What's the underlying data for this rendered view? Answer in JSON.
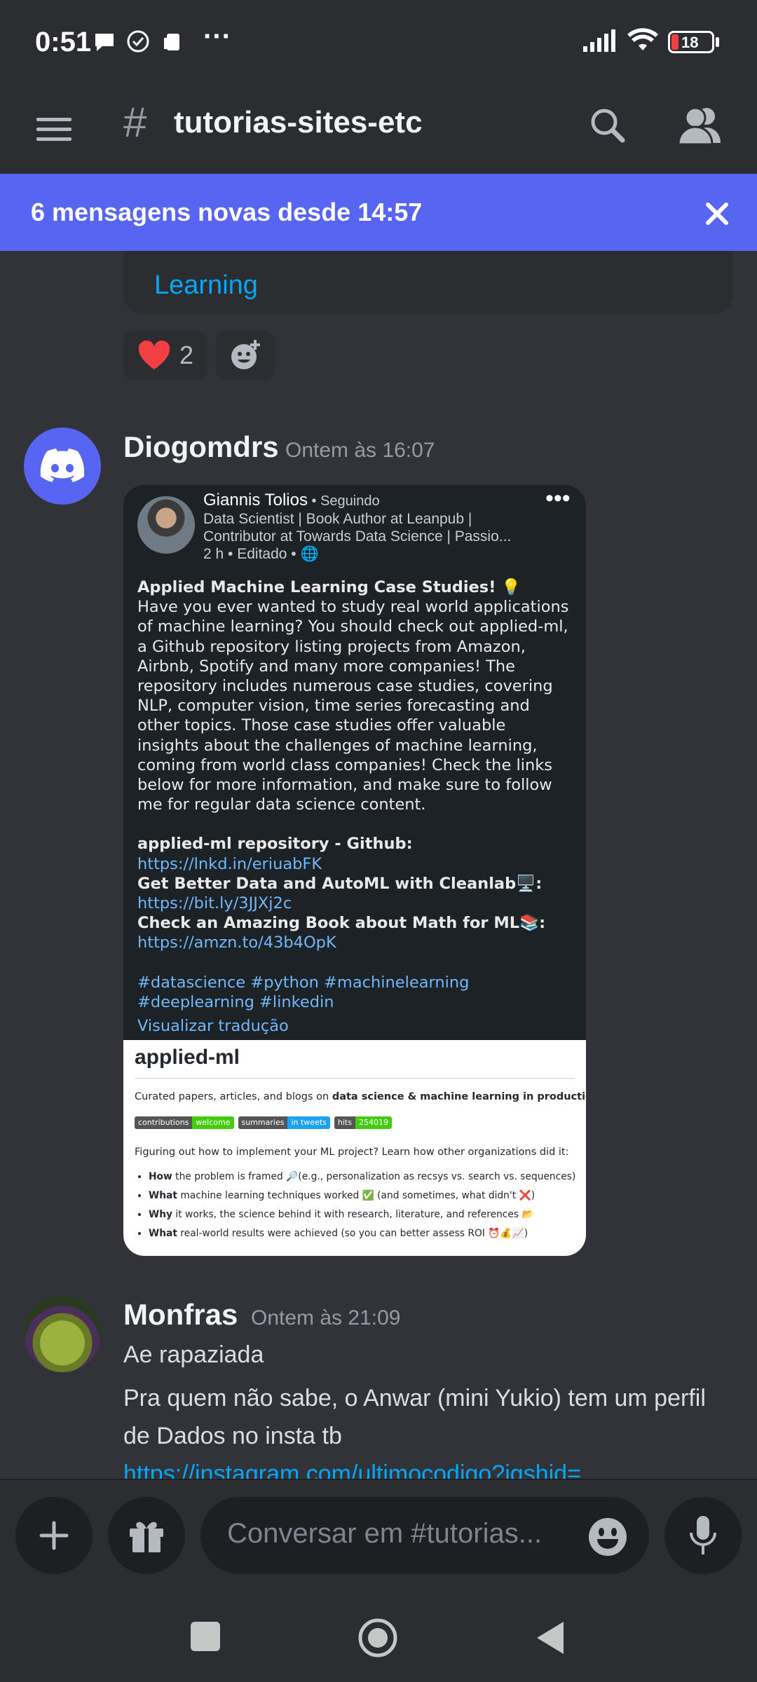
{
  "status": {
    "time": "0:51",
    "more": "···",
    "battery": "18"
  },
  "header": {
    "channel": "tutorias-sites-etc"
  },
  "banner": {
    "text": "6 mensagens novas desde 14:57"
  },
  "prev_message": {
    "link_tail": "Learning",
    "reaction_count": "2"
  },
  "messages": [
    {
      "author": "Diogomdrs",
      "timestamp": "Ontem às 16:07",
      "embed": {
        "poster_name": "Giannis Tolios",
        "follow": " • Seguindo",
        "headline1": "Data Scientist | Book Author at Leanpub |",
        "headline2": "Contributor at Towards Data Science | Passio...",
        "meta": "2 h • Editado • ",
        "title": "Applied Machine Learning Case Studies! 💡",
        "body": "Have you ever wanted to study real world applications of machine learning? You should check out applied-ml, a Github repository listing projects from Amazon, Airbnb, Spotify and many more companies! The repository includes numerous case studies, covering NLP, computer vision, time series forecasting and other topics. Those case studies offer valuable insights about the challenges of machine learning, coming from world class companies! Check the links below for more information, and make sure to follow me for regular data science content.",
        "line1_label": "applied-ml repository - Github: ",
        "line1_link": "https://lnkd.in/eriuabFK",
        "line2_label": "Get Better Data and AutoML with Cleanlab🖥️: ",
        "line2_link": "https://bit.ly/3JJXj2c",
        "line3_label": "Check an Amazing Book about Math for ML📚: ",
        "line3_link": "https://amzn.to/43b4OpK",
        "hashtags": "#datascience #python #machinelearning #deeplearning #linkedin",
        "translate": "Visualizar tradução",
        "repo": {
          "title": "applied-ml",
          "desc_pre": "Curated papers, articles, and blogs on ",
          "desc_bold": "data science & machine learning in production.",
          "desc_icon": "⚙️",
          "badges": [
            {
              "l": "contributions",
              "r": "welcome",
              "color": "#4c1"
            },
            {
              "l": "summaries",
              "r": "in tweets",
              "color": "#1da1f2"
            },
            {
              "l": "hits",
              "r": "254019",
              "color": "#4c1"
            }
          ],
          "question": "Figuring out how to implement your ML project? Learn how other organizations did it:",
          "bullets": [
            {
              "b": "How",
              "t": " the problem is framed 🔎(e.g., personalization as recsys vs. search vs. sequences)"
            },
            {
              "b": "What",
              "t": " machine learning techniques worked ✅ (and sometimes, what didn't ❌)"
            },
            {
              "b": "Why",
              "t": " it works, the science behind it with research, literature, and references 📂"
            },
            {
              "b": "What",
              "t": " real-world results were achieved (so you can better assess ROI ⏰💰📈)"
            }
          ]
        }
      }
    },
    {
      "author": "Monfras",
      "timestamp": "Ontem às 21:09",
      "line1": "Ae rapaziada",
      "line2": "Pra quem não sabe, o Anwar (mini Yukio) tem um perfil de Dados no insta tb",
      "link": "https://instagram.com/ultimocodigo?igshid="
    }
  ],
  "composer": {
    "placeholder": "Conversar em #tutorias..."
  },
  "colors": {
    "blurple": "#5865f2",
    "link": "#00a8fc",
    "bg": "#313338"
  }
}
